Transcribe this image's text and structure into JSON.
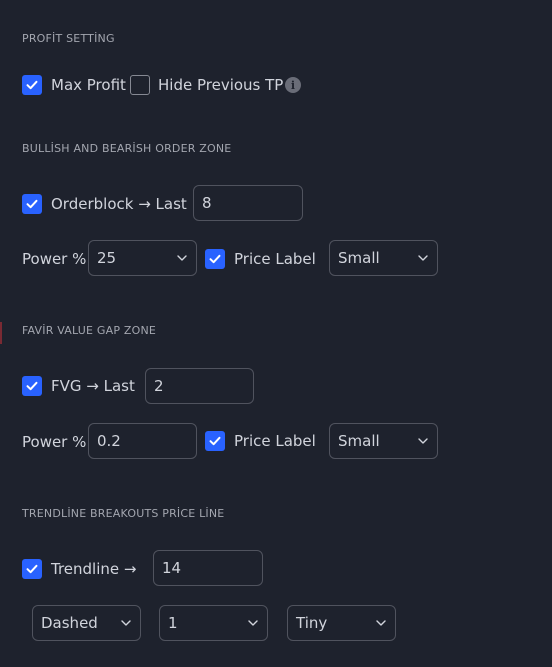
{
  "profit": {
    "section_title": "PROFİT SETTİNG",
    "max_profit_label": "Max Profit",
    "max_profit_checked": true,
    "hide_tp_label": "Hide Previous TP",
    "hide_tp_checked": false,
    "info_glyph": "i"
  },
  "order_zone": {
    "section_title": "BULLİSH AND BEARİSH ORDER ZONE",
    "orderblock_label": "Orderblock →  Last",
    "orderblock_checked": true,
    "last_value": "8",
    "power_label": "Power %",
    "power_value": "25",
    "price_label": "Price Label",
    "price_label_checked": true,
    "size_value": "Small"
  },
  "fvg_zone": {
    "section_title": "FAVİR VALUE GAP ZONE",
    "fvg_label": "FVG →  Last",
    "fvg_checked": true,
    "last_value": "2",
    "power_label": "Power %",
    "power_value": "0.2",
    "price_label": "Price Label",
    "price_label_checked": true,
    "size_value": "Small"
  },
  "trendline": {
    "section_title": "TRENDLİNE BREAKOUTS PRİCE LİNE",
    "trendline_label": "Trendline →",
    "trendline_checked": true,
    "length_value": "14",
    "style_value": "Dashed",
    "width_value": "1",
    "size_value": "Tiny"
  },
  "colors": {
    "accent": "#2962ff",
    "background": "#1e222d",
    "border": "#50535e"
  }
}
